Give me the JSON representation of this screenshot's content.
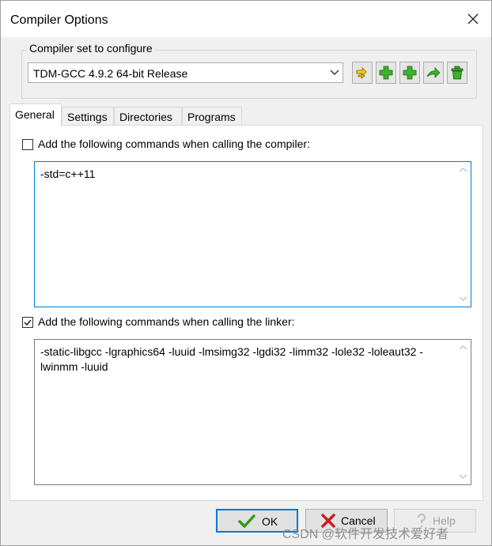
{
  "window": {
    "title": "Compiler Options"
  },
  "compiler_set": {
    "legend": "Compiler set to configure",
    "selected": "TDM-GCC 4.9.2 64-bit Release",
    "toolbar_icons": [
      "find-compilers-icon",
      "add-compiler-icon",
      "add-compiler-folder-icon",
      "rename-icon",
      "delete-icon"
    ]
  },
  "tabs": [
    "General",
    "Settings",
    "Directories",
    "Programs"
  ],
  "active_tab": "General",
  "general": {
    "compiler_checkbox_label": "Add the following commands when calling the compiler:",
    "compiler_checked": false,
    "compiler_commands": "-std=c++11",
    "linker_checkbox_label": "Add the following commands when calling the linker:",
    "linker_checked": true,
    "linker_commands": "-static-libgcc -lgraphics64 -luuid -lmsimg32 -lgdi32 -limm32 -lole32 -loleaut32 -lwinmm -luuid"
  },
  "buttons": {
    "ok": "OK",
    "cancel": "Cancel",
    "help": "Help"
  },
  "watermark": "CSDN @软件开发技术爱好者",
  "colors": {
    "focus_border": "#0078d7",
    "ok_icon": "#2e9c1a",
    "cancel_icon": "#c81e1e",
    "add_icon": "#33aa22"
  }
}
